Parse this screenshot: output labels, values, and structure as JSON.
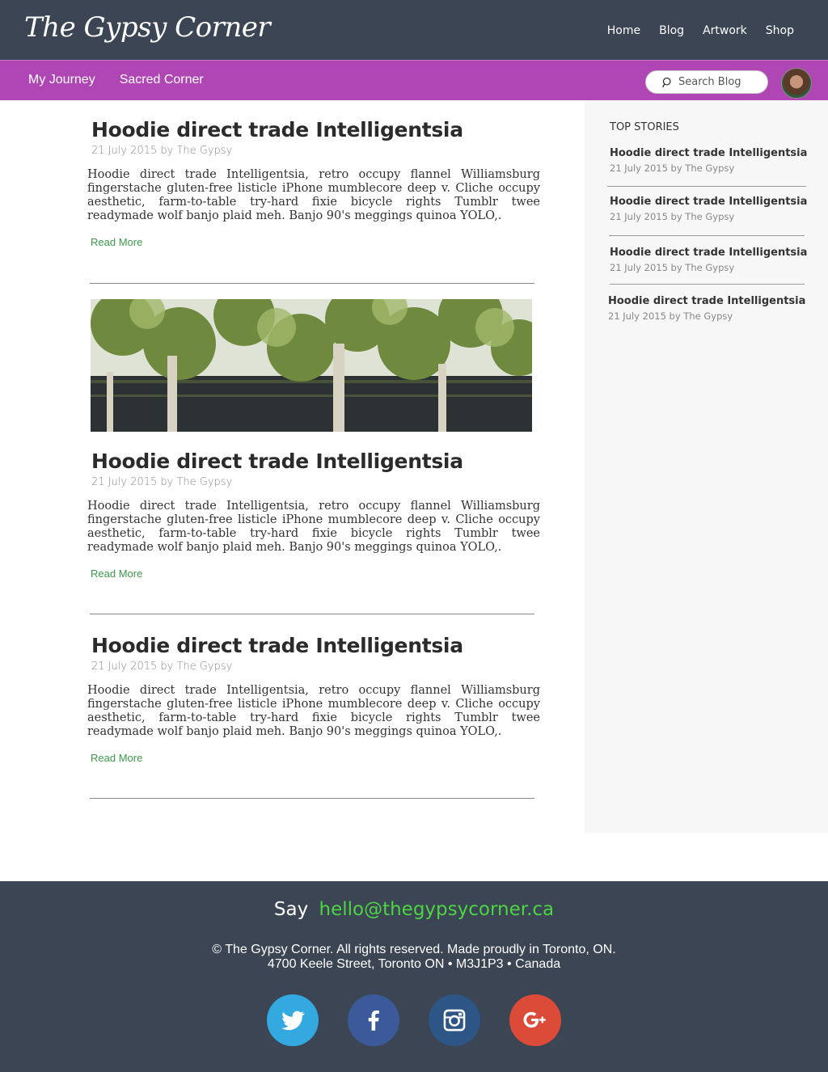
{
  "header": {
    "brand": "The Gypsy Corner",
    "nav": [
      "Home",
      "Blog",
      "Artwork",
      "Shop"
    ]
  },
  "subnav": {
    "items": [
      "My Journey",
      "Sacred Corner"
    ],
    "search_placeholder": "Search Blog"
  },
  "posts": [
    {
      "title": "Hoodie direct trade Intelligentsia",
      "meta": "21 July 2015 by The Gypsy",
      "body": "Hoodie direct trade Intelligentsia, retro occupy flannel Williamsburg fingerstache gluten-free listicle iPhone mumblecore deep v. Cliche occupy aesthetic, farm-to-table try-hard fixie bicycle rights Tumblr twee readymade wolf banjo plaid meh. Banjo 90's meggings quinoa YOLO,.",
      "read_more": "Read More"
    },
    {
      "title": "Hoodie direct trade Intelligentsia",
      "meta": "21 July 2015 by The Gypsy",
      "body": "Hoodie direct trade Intelligentsia, retro occupy flannel Williamsburg fingerstache gluten-free listicle iPhone mumblecore deep v. Cliche occupy aesthetic, farm-to-table try-hard fixie bicycle rights Tumblr twee readymade wolf banjo plaid meh. Banjo 90's meggings quinoa YOLO,.",
      "read_more": "Read More"
    },
    {
      "title": "Hoodie direct trade Intelligentsia",
      "meta": "21 July 2015 by The Gypsy",
      "body": "Hoodie direct trade Intelligentsia, retro occupy flannel Williamsburg fingerstache gluten-free listicle iPhone mumblecore deep v. Cliche occupy aesthetic, farm-to-table try-hard fixie bicycle rights Tumblr twee readymade wolf banjo plaid meh. Banjo 90's meggings quinoa YOLO,.",
      "read_more": "Read More"
    }
  ],
  "sidebar": {
    "heading": "TOP STORIES",
    "stories": [
      {
        "title": "Hoodie direct trade Intelligentsia",
        "meta": "21 July 2015 by The Gypsy"
      },
      {
        "title": "Hoodie direct trade Intelligentsia",
        "meta": "21 July 2015 by The Gypsy"
      },
      {
        "title": "Hoodie direct trade Intelligentsia",
        "meta": "21 July 2015 by The Gypsy"
      },
      {
        "title": "Hoodie direct trade Intelligentsia",
        "meta": "21 July 2015 by The Gypsy"
      }
    ]
  },
  "footer": {
    "say": "Say",
    "email": "hello@thegypsycorner.ca",
    "copyright": "© The Gypsy Corner. All rights reserved. Made proudly in Toronto, ON.",
    "address": "4700 Keele Street, Toronto ON • M3J1P3 • Canada",
    "socials": [
      "twitter-icon",
      "facebook-icon",
      "instagram-icon",
      "google-plus-icon"
    ]
  },
  "colors": {
    "header_bg": "#3b4554",
    "subnav_bg": "#b046b4",
    "link_green": "#3a9a4a",
    "email_green": "#4cd443"
  }
}
